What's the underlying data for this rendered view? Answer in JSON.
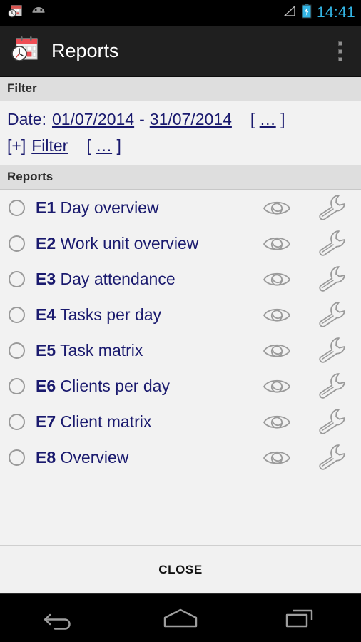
{
  "statusbar": {
    "time": "14:41",
    "icons": [
      "calendar-clock-notification-icon",
      "android-head-icon",
      "signal-icon",
      "battery-charging-icon"
    ]
  },
  "actionbar": {
    "app_icon": "calendar-clock-app-icon",
    "title": "Reports",
    "overflow_label": "overflow-menu"
  },
  "filter": {
    "header": "Filter",
    "date_label": "Date:",
    "date_from": "01/07/2014",
    "date_separator": "-",
    "date_to": "31/07/2014",
    "date_more": "[ … ]",
    "add_filter_prefix": "[+]",
    "add_filter_label": "Filter",
    "filter_more": "[ … ]"
  },
  "reports": {
    "header": "Reports",
    "items": [
      {
        "code": "E1",
        "name": "Day overview",
        "selected": false
      },
      {
        "code": "E2",
        "name": "Work unit overview",
        "selected": false
      },
      {
        "code": "E3",
        "name": "Day attendance",
        "selected": false
      },
      {
        "code": "E4",
        "name": "Tasks per day",
        "selected": false
      },
      {
        "code": "E5",
        "name": "Task matrix",
        "selected": false
      },
      {
        "code": "E6",
        "name": "Clients per day",
        "selected": false
      },
      {
        "code": "E7",
        "name": "Client matrix",
        "selected": false
      },
      {
        "code": "E8",
        "name": "Overview",
        "selected": false
      }
    ],
    "preview_icon": "eye-icon",
    "settings_icon": "wrench-icon"
  },
  "footer": {
    "close_label": "CLOSE"
  },
  "navbar": {
    "back": "back-icon",
    "home": "home-icon",
    "recents": "recents-icon"
  },
  "colors": {
    "link": "#1a1a6e",
    "accent_blue": "#33b5e5",
    "band": "#dedede",
    "page_bg": "#f2f2f2",
    "icon_gray": "#9a9a9a",
    "app_icon_red": "#e8505b"
  }
}
